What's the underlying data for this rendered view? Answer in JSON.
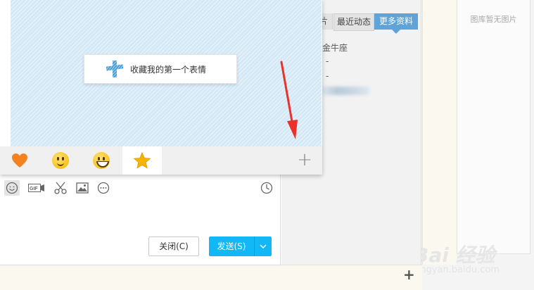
{
  "library": {
    "empty_text": "图库暂无图片"
  },
  "profile": {
    "tabs": [
      {
        "label": "片"
      },
      {
        "label": "最近动态"
      },
      {
        "label": "更多资料"
      }
    ],
    "lines": [
      "金牛座",
      "-",
      "-"
    ]
  },
  "emoji_popup": {
    "collect_label": "收藏我的第一个表情",
    "tabs": [
      {
        "icon": "heart-icon"
      },
      {
        "icon": "smile-face-icon"
      },
      {
        "icon": "grin-face-icon"
      },
      {
        "icon": "star-icon",
        "active": true
      }
    ],
    "add_icon": "plus-icon",
    "add_label": "+"
  },
  "toolbar": {
    "items": [
      "emoji-icon",
      "gif-icon",
      "scissors-icon",
      "image-icon",
      "more-icon",
      "history-icon"
    ],
    "gif_label": "GIF"
  },
  "actions": {
    "close_label": "关闭(C)",
    "send_label": "发送(S)"
  },
  "bottom": {
    "plus_label": "+"
  },
  "watermark": {
    "logo": "Bai 经验",
    "url": "jingyan.baidu.com"
  },
  "colors": {
    "accent": "#12b7f5",
    "tab_active": "#5fa3d9",
    "emoji_bg": "#d5e8f6",
    "annotation_arrow": "#e8322b"
  }
}
